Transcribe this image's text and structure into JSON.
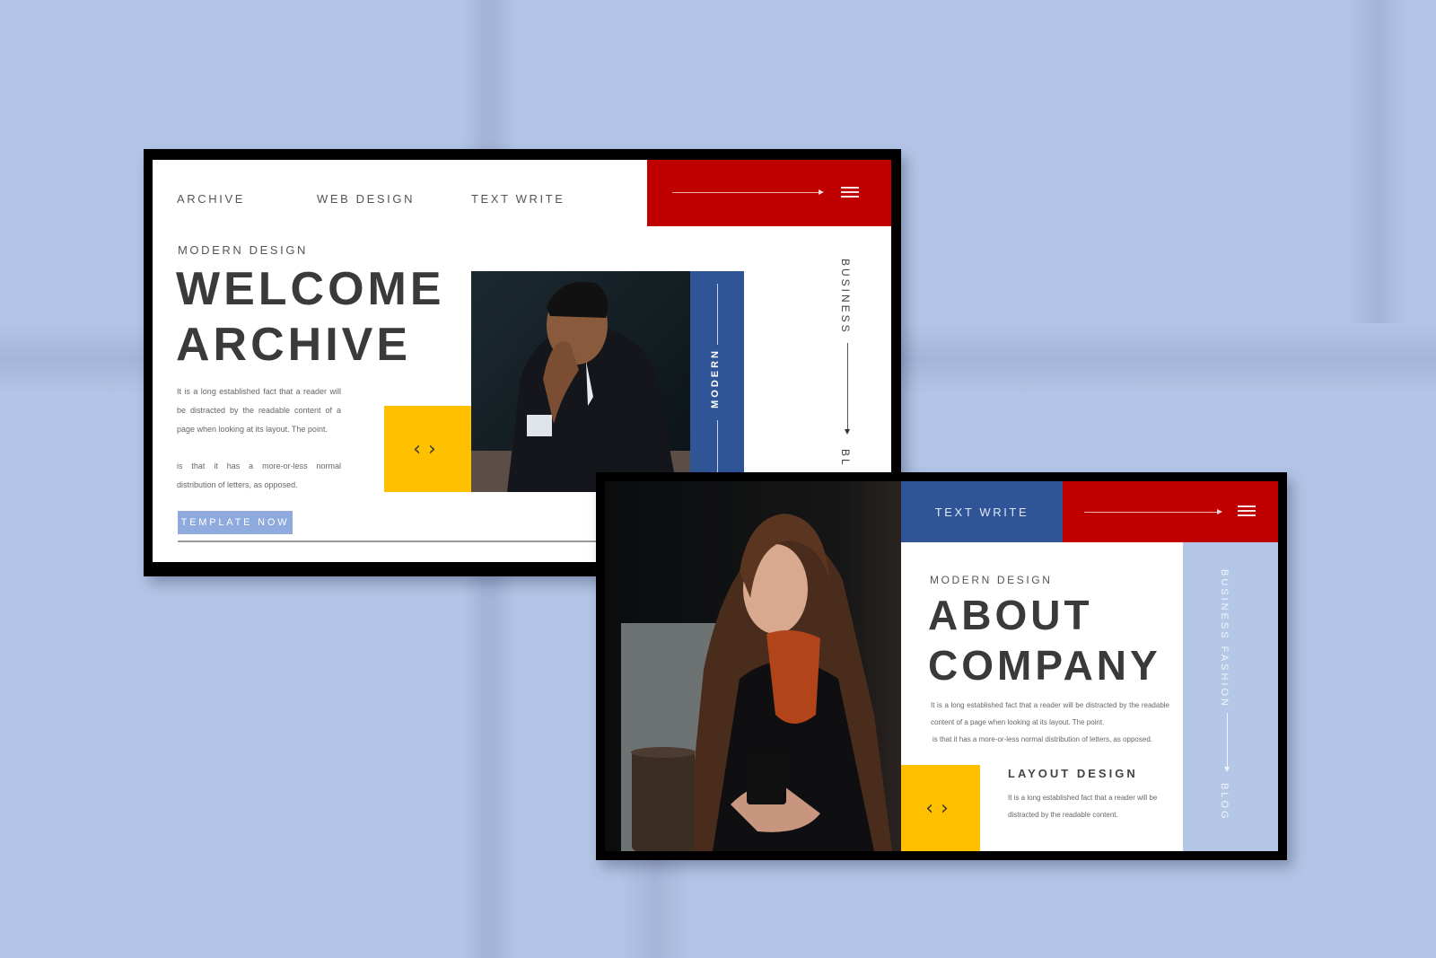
{
  "background": {
    "color": "#b3c5e6"
  },
  "colors": {
    "red": "#c00000",
    "blue": "#2f5597",
    "yellow": "#ffc000",
    "lilac": "#b4c7e7",
    "button_blue": "#8faadc"
  },
  "slide1": {
    "nav": [
      "ARCHIVE",
      "WEB DESIGN",
      "TEXT WRITE"
    ],
    "menu_icon": "hamburger-icon",
    "arrow_icon": "arrow-right-icon",
    "kicker": "MODERN DESIGN",
    "headline": [
      "WELCOME",
      "ARCHIVE"
    ],
    "body_para1": "It is a long established fact that a reader will be distracted by the readable content of a page when looking at its layout. The point.",
    "body_para2": "is that it has a more-or-less normal distribution of letters, as opposed.",
    "code_icon": "code-brackets-icon",
    "strip_label": "MODERN",
    "side_label_top": "BUSINESS",
    "side_label_bottom": "BL",
    "button_label": "TEMPLATE NOW"
  },
  "slide2": {
    "tab_label": "TEXT WRITE",
    "menu_icon": "hamburger-icon",
    "arrow_icon": "arrow-right-icon",
    "kicker": "MODERN DESIGN",
    "headline": [
      "ABOUT",
      "COMPANY"
    ],
    "body_line1": "It is a long established fact that a reader will be distracted by the readable content of a page when looking at its layout. The point.",
    "body_line2": "is that it has a more-or-less normal distribution of letters, as opposed.",
    "code_icon": "code-brackets-icon",
    "sub_heading": "LAYOUT DESIGN",
    "sub_body": "It is a long established fact that a reader will be distracted by the readable content.",
    "side_label_top": "BUSINESS FASHION",
    "side_label_bottom": "BLOG"
  }
}
